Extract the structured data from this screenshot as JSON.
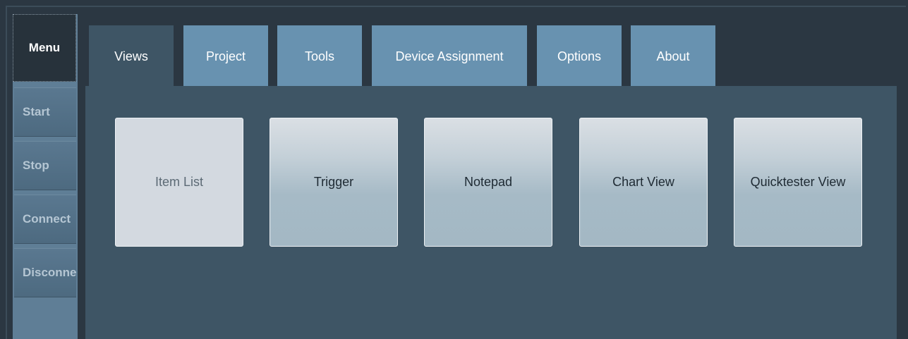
{
  "sidebar": {
    "menu_label": "Menu",
    "items": [
      {
        "label": "Start"
      },
      {
        "label": "Stop"
      },
      {
        "label": "Connect"
      },
      {
        "label": "Disconnect"
      }
    ]
  },
  "tabs": [
    {
      "label": "Views",
      "active": true
    },
    {
      "label": "Project"
    },
    {
      "label": "Tools"
    },
    {
      "label": "Device Assignment"
    },
    {
      "label": "Options"
    },
    {
      "label": "About"
    }
  ],
  "views": {
    "tiles": [
      {
        "label": "Item List",
        "selected": true
      },
      {
        "label": "Trigger"
      },
      {
        "label": "Notepad"
      },
      {
        "label": "Chart View"
      },
      {
        "label": "Quicktester View"
      }
    ]
  },
  "colors": {
    "background": "#2b3742",
    "tab": "#6892b0",
    "active_tab": "#3e5565",
    "sidebar": "#5f7e96"
  }
}
